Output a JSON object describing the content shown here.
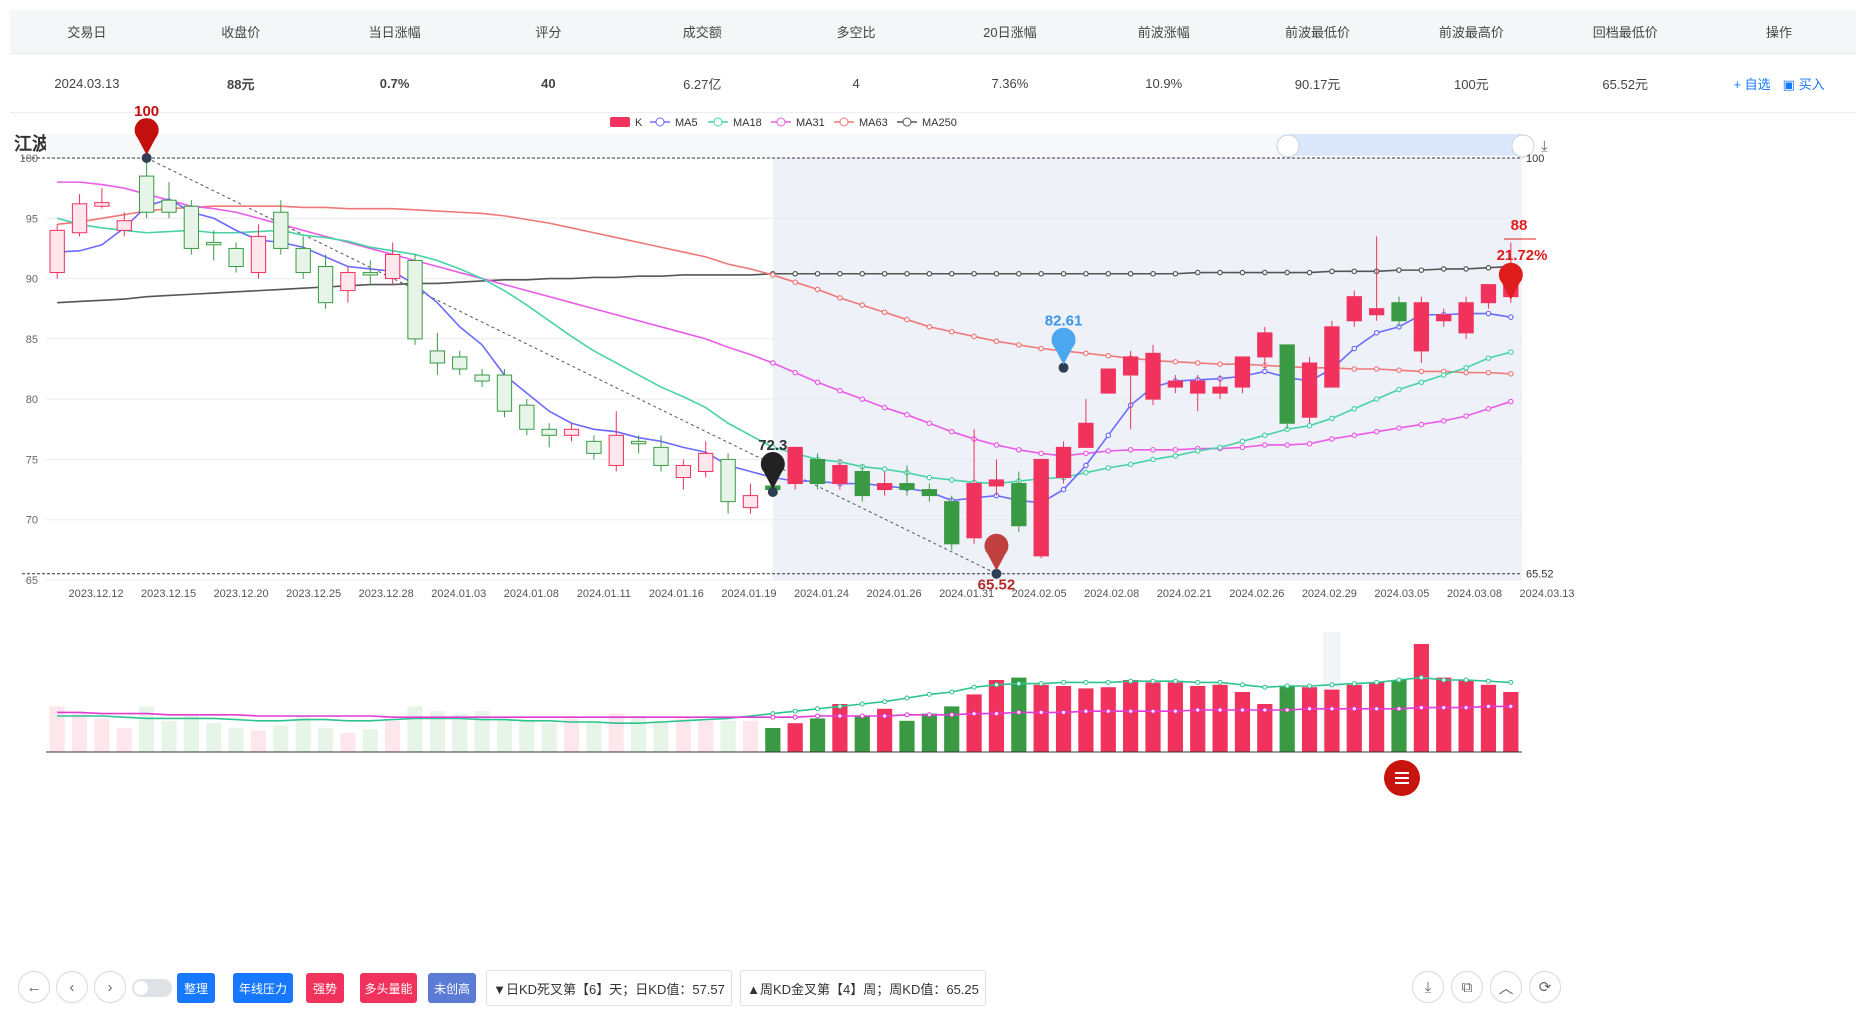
{
  "table": {
    "headers": [
      "交易日",
      "收盘价",
      "当日涨幅",
      "评分",
      "成交额",
      "多空比",
      "20日涨幅",
      "前波涨幅",
      "前波最低价",
      "前波最高价",
      "回档最低价",
      "操作"
    ],
    "row": {
      "date": "2024.03.13",
      "close": "88元",
      "change": "0.7%",
      "score": "40",
      "turnover": "6.27亿",
      "ratio": "4",
      "chg20": "7.36%",
      "wave_chg": "10.9%",
      "wave_low": "90.17元",
      "wave_high": "100元",
      "pullback_low": "65.52元",
      "op_watch": "+ 自选",
      "op_buy": "买入"
    }
  },
  "chart_title": "江波龙（电子）",
  "legend": [
    "K",
    "MA5",
    "MA18",
    "MA31",
    "MA63",
    "MA250"
  ],
  "colors": {
    "up": "#f0325d",
    "down": "#3a9a44",
    "ma5": "#6b6bff",
    "ma18": "#47d3a6",
    "ma31": "#ea5ce8",
    "ma63": "#f07878",
    "ma250": "#555555",
    "accent": "#1677ff"
  },
  "icons": {
    "refresh": "refresh-icon",
    "zoom": "zoom-icon",
    "zoom_reset": "zoom-reset-icon",
    "restore": "restore-icon",
    "crosshair": "crosshair-icon",
    "download": "download-icon"
  },
  "chart_data": {
    "type": "candlestick",
    "ylim": [
      65,
      100
    ],
    "y_ticks": [
      65,
      70,
      75,
      80,
      85,
      90,
      95,
      100
    ],
    "x_tick_labels": [
      "2023.12.12",
      "2023.12.15",
      "2023.12.20",
      "2023.12.25",
      "2023.12.28",
      "2024.01.03",
      "2024.01.08",
      "2024.01.11",
      "2024.01.16",
      "2024.01.19",
      "2024.01.24",
      "2024.01.26",
      "2024.01.31",
      "2024.02.05",
      "2024.02.08",
      "2024.02.21",
      "2024.02.26",
      "2024.02.29",
      "2024.03.05",
      "2024.03.08",
      "2024.03.13"
    ],
    "candles": [
      [
        90.5,
        94,
        90,
        94.5
      ],
      [
        93.8,
        96.2,
        93.5,
        97
      ],
      [
        96,
        96.3,
        95.8,
        97.5
      ],
      [
        94,
        94.8,
        93.5,
        95.5
      ],
      [
        98.5,
        95.5,
        95,
        100
      ],
      [
        96.5,
        95.5,
        95,
        98
      ],
      [
        96,
        92.5,
        92,
        96.5
      ],
      [
        93,
        92.8,
        91.5,
        94
      ],
      [
        92.5,
        91,
        90.5,
        93
      ],
      [
        90.5,
        93.5,
        90,
        94.5
      ],
      [
        95.5,
        92.5,
        92,
        96.5
      ],
      [
        92.5,
        90.5,
        90,
        93.5
      ],
      [
        91,
        88,
        87.5,
        92
      ],
      [
        89,
        90.5,
        88,
        91
      ],
      [
        90.5,
        90.3,
        89.5,
        91.5
      ],
      [
        90,
        92,
        89.5,
        93
      ],
      [
        91.5,
        85,
        84.5,
        92
      ],
      [
        84,
        83,
        82,
        85.5
      ],
      [
        83.5,
        82.5,
        82,
        84
      ],
      [
        82,
        81.5,
        81,
        82.5
      ],
      [
        82,
        79,
        78.5,
        82.5
      ],
      [
        79.5,
        77.5,
        77,
        80
      ],
      [
        77.5,
        77,
        76,
        78
      ],
      [
        77,
        77.5,
        76.5,
        78
      ],
      [
        76.5,
        75.5,
        75,
        77
      ],
      [
        74.5,
        77,
        74,
        79
      ],
      [
        76.5,
        76.3,
        75.5,
        77
      ],
      [
        76,
        74.5,
        74,
        77
      ],
      [
        73.5,
        74.5,
        72.5,
        75
      ],
      [
        74,
        75.5,
        73.5,
        76.5
      ],
      [
        75,
        71.5,
        70.5,
        75.5
      ],
      [
        71,
        72,
        70.5,
        73
      ],
      [
        72.8,
        72.5,
        72,
        73.5
      ],
      [
        73,
        76,
        72.5,
        76
      ],
      [
        75,
        73,
        72.5,
        75.5
      ],
      [
        73,
        74.5,
        72.5,
        75
      ],
      [
        74,
        72,
        71.5,
        74.5
      ],
      [
        72.5,
        73,
        72,
        74
      ],
      [
        73,
        72.5,
        72,
        74.5
      ],
      [
        72.5,
        72,
        71.5,
        73
      ],
      [
        71.5,
        68,
        67.5,
        72
      ],
      [
        68.5,
        73,
        68,
        77.5
      ],
      [
        72.8,
        73.3,
        72,
        75
      ],
      [
        73,
        69.5,
        69,
        74
      ],
      [
        67,
        75,
        66.8,
        75
      ],
      [
        73.5,
        76,
        73,
        76.5
      ],
      [
        76,
        78,
        76,
        80
      ],
      [
        80.5,
        82.5,
        80.5,
        82.5
      ],
      [
        82,
        83.5,
        77.5,
        84
      ],
      [
        80,
        83.8,
        79.5,
        84.5
      ],
      [
        81,
        81.5,
        80.5,
        82
      ],
      [
        80.5,
        81.5,
        79,
        82
      ],
      [
        80.5,
        81,
        80,
        82
      ],
      [
        81,
        83.5,
        80.5,
        83.5
      ],
      [
        83.5,
        85.5,
        82.5,
        86
      ],
      [
        84.5,
        78,
        77.5,
        84.5
      ],
      [
        78.5,
        83,
        78,
        83.5
      ],
      [
        81,
        86,
        81,
        86.5
      ],
      [
        86.5,
        88.5,
        86,
        89
      ],
      [
        87,
        87.5,
        86.5,
        93.5
      ],
      [
        88,
        86.5,
        86,
        88.5
      ],
      [
        84,
        88,
        83,
        88.5
      ],
      [
        86.5,
        87,
        86,
        87.5
      ],
      [
        85.5,
        88,
        85,
        88.5
      ],
      [
        88,
        89.5,
        87.5,
        89.5
      ],
      [
        88.5,
        90,
        88,
        93
      ]
    ],
    "ma5": [
      92.2,
      92.3,
      92.8,
      94.2,
      96,
      96.6,
      95.5,
      95,
      94,
      93.2,
      93,
      92.6,
      91.8,
      91,
      90.8,
      90.6,
      89.5,
      88,
      86,
      84.5,
      82,
      80.5,
      79,
      78,
      77.5,
      77.3,
      76.8,
      76.5,
      76,
      75.6,
      74.5,
      74,
      73.5,
      73.2,
      73.2,
      73,
      73,
      72.8,
      72.6,
      72.3,
      71.6,
      71.8,
      72,
      71.6,
      71.4,
      72.5,
      74.5,
      77,
      79.5,
      81,
      81.5,
      81.6,
      81.7,
      81.9,
      82.3,
      81.8,
      81.5,
      82.5,
      84.2,
      85.5,
      86,
      87,
      87,
      87.1,
      87.1,
      86.8
    ],
    "ma18": [
      95,
      94.5,
      94.2,
      94,
      93.8,
      93.9,
      94,
      93.8,
      93.8,
      93.9,
      94,
      93.6,
      93.4,
      93.1,
      92.6,
      92.3,
      92,
      91.5,
      90.8,
      90,
      89,
      87.8,
      86.5,
      85.2,
      84,
      83,
      82,
      81,
      80.2,
      79.3,
      78,
      77,
      76,
      75.5,
      75,
      74.8,
      74.4,
      74.2,
      73.9,
      73.5,
      73.3,
      73.1,
      73,
      73.2,
      73.4,
      73.5,
      73.9,
      74.3,
      74.6,
      75,
      75.3,
      75.7,
      76,
      76.5,
      77,
      77.5,
      77.8,
      78.4,
      79.2,
      80,
      80.8,
      81.4,
      82,
      82.6,
      83.4,
      83.9
    ],
    "ma31": [
      98,
      98,
      97.8,
      97.5,
      97,
      96.5,
      96,
      95.8,
      95.5,
      95,
      94.5,
      94,
      93.5,
      93,
      92.5,
      92,
      91.5,
      91,
      90.5,
      90,
      89.5,
      89,
      88.5,
      88,
      87.5,
      87,
      86.5,
      86,
      85.5,
      85,
      84.3,
      83.7,
      83,
      82.2,
      81.4,
      80.7,
      80,
      79.3,
      78.7,
      78,
      77.3,
      76.7,
      76.2,
      75.8,
      75.5,
      75.3,
      75.5,
      75.7,
      75.8,
      75.8,
      75.8,
      75.9,
      75.9,
      76,
      76.2,
      76.2,
      76.3,
      76.7,
      77,
      77.3,
      77.6,
      77.9,
      78.2,
      78.6,
      79.2,
      79.8
    ],
    "ma63": [
      94.5,
      94.7,
      95,
      95.3,
      95.6,
      95.8,
      95.9,
      96,
      96,
      96,
      96,
      95.9,
      95.9,
      95.8,
      95.8,
      95.8,
      95.7,
      95.6,
      95.5,
      95.4,
      95.2,
      94.9,
      94.6,
      94.2,
      93.8,
      93.4,
      93,
      92.6,
      92.2,
      91.8,
      91.2,
      90.8,
      90.3,
      89.7,
      89.1,
      88.4,
      87.8,
      87.2,
      86.6,
      86,
      85.6,
      85.2,
      84.8,
      84.5,
      84.2,
      84,
      83.8,
      83.6,
      83.4,
      83.2,
      83.1,
      83,
      82.9,
      82.9,
      82.8,
      82.7,
      82.6,
      82.6,
      82.5,
      82.5,
      82.4,
      82.3,
      82.3,
      82.2,
      82.2,
      82.1
    ],
    "ma250": [
      88,
      88.1,
      88.2,
      88.3,
      88.5,
      88.6,
      88.7,
      88.8,
      88.9,
      89,
      89.1,
      89.2,
      89.3,
      89.4,
      89.5,
      89.5,
      89.6,
      89.6,
      89.7,
      89.8,
      89.9,
      89.9,
      90,
      90,
      90.1,
      90.1,
      90.2,
      90.2,
      90.3,
      90.3,
      90.3,
      90.3,
      90.4,
      90.4,
      90.4,
      90.4,
      90.4,
      90.4,
      90.4,
      90.4,
      90.4,
      90.4,
      90.4,
      90.4,
      90.4,
      90.4,
      90.4,
      90.4,
      90.4,
      90.4,
      90.4,
      90.5,
      90.5,
      90.5,
      90.5,
      90.5,
      90.5,
      90.6,
      90.6,
      90.6,
      90.7,
      90.7,
      90.8,
      90.8,
      90.9,
      91
    ],
    "volume": [
      38,
      32,
      28,
      20,
      38,
      26,
      30,
      24,
      20,
      18,
      22,
      30,
      20,
      16,
      19,
      26,
      38,
      34,
      32,
      34,
      28,
      26,
      24,
      28,
      26,
      32,
      30,
      26,
      28,
      26,
      26,
      26,
      20,
      24,
      28,
      40,
      30,
      36,
      26,
      32,
      38,
      48,
      60,
      62,
      56,
      55,
      53,
      54,
      60,
      58,
      58,
      55,
      56,
      50,
      40,
      55,
      54,
      52,
      56,
      58,
      60,
      90,
      62,
      60,
      56,
      50
    ],
    "vol_ma_a": [
      30,
      30,
      30,
      29,
      28,
      28,
      28,
      28,
      27,
      26,
      26,
      27,
      27,
      26,
      26,
      27,
      28,
      28,
      28,
      27,
      27,
      26,
      26,
      25,
      25,
      24,
      24,
      25,
      26,
      27,
      28,
      30,
      32,
      34,
      36,
      38,
      40,
      42,
      45,
      48,
      50,
      54,
      56,
      57,
      57,
      58,
      58,
      58,
      59,
      59,
      59,
      58,
      58,
      56,
      54,
      55,
      55,
      56,
      57,
      58,
      60,
      62,
      60,
      60,
      59,
      58
    ],
    "vol_ma_b": [
      33,
      33,
      32,
      32,
      32,
      31,
      31,
      31,
      31,
      30,
      30,
      30,
      30,
      30,
      30,
      29,
      29,
      29,
      29,
      29,
      29,
      29,
      29,
      29,
      29,
      29,
      29,
      29,
      29,
      29,
      29,
      29,
      29,
      29,
      30,
      30,
      30,
      30,
      31,
      31,
      31,
      32,
      32,
      33,
      33,
      33,
      34,
      34,
      34,
      34,
      34,
      35,
      35,
      35,
      35,
      35,
      36,
      36,
      36,
      36,
      36,
      37,
      37,
      37,
      38,
      38
    ],
    "annotations": {
      "peak": "100",
      "peak_left": "100",
      "trough": "65.52",
      "trough_label": "65.52",
      "p_72": "72.3",
      "p_8261": "82.61",
      "last_price": "88",
      "last_pct": "21.72%",
      "axis_right_top": "100",
      "axis_right_bottom": "65.52"
    }
  },
  "bottom": {
    "tags": [
      {
        "label": "整理",
        "color": "#1677ff"
      },
      {
        "label": "年线压力",
        "color": "#1677ff"
      },
      {
        "label": "强势",
        "color": "#f0325d"
      },
      {
        "label": "多头量能",
        "color": "#f0325d"
      },
      {
        "label": "未创高",
        "color": "#5b7bd5"
      }
    ],
    "info1": "▼日KD死叉第【6】天；日KD值：57.57",
    "info2": "▲周KD金叉第【4】周；周KD值：65.25"
  }
}
